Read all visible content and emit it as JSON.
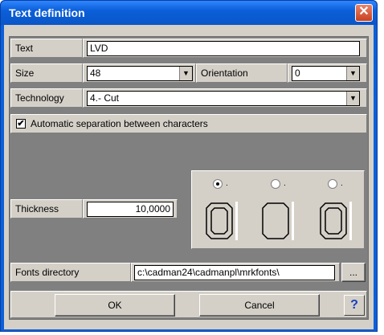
{
  "window": {
    "title": "Text definition",
    "close_glyph": "✕"
  },
  "text_row": {
    "label": "Text",
    "value": "LVD"
  },
  "size_row": {
    "label": "Size",
    "value": "48"
  },
  "orientation_row": {
    "label": "Orientation",
    "value": "0"
  },
  "technology_row": {
    "label": "Technology",
    "value": "4.- Cut"
  },
  "auto_separation": {
    "label": "Automatic separation between characters",
    "checked": true,
    "check_glyph": "✔"
  },
  "thickness_row": {
    "label": "Thickness",
    "value": "10,0000"
  },
  "orientation_options": [
    {
      "selected": true,
      "dot": "."
    },
    {
      "selected": false,
      "dot": "."
    },
    {
      "selected": false,
      "dot": "."
    }
  ],
  "fonts_row": {
    "label": "Fonts directory",
    "value": "c:\\cadman24\\cadmanpl\\mrkfonts\\",
    "browse_label": "..."
  },
  "buttons": {
    "ok": "OK",
    "cancel": "Cancel",
    "help": "?"
  },
  "icons": {
    "dropdown": "chevron-down-icon",
    "help": "help-icon",
    "close": "close-icon"
  },
  "colors": {
    "titlebar": "#0b5fd9",
    "dialog_face": "#d4d0c8",
    "close_button": "#c9401f"
  }
}
